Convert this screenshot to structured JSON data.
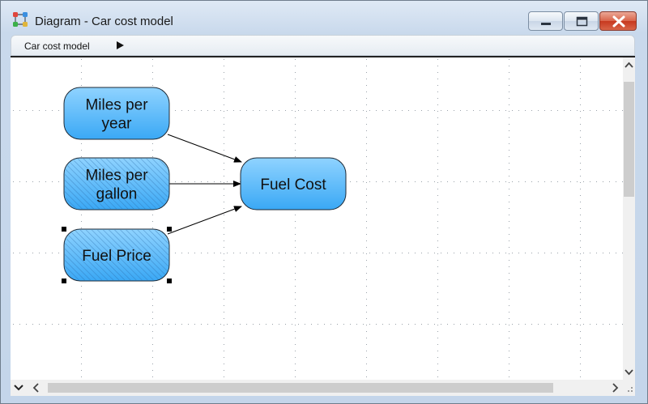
{
  "window": {
    "title": "Diagram - Car cost model",
    "icon": "diagram-app-icon"
  },
  "breadcrumb": {
    "items": [
      "Car cost model"
    ],
    "separator_icon": "triangle-right-icon"
  },
  "diagram": {
    "nodes": [
      {
        "id": "miles-per-year",
        "lines": [
          "Miles per",
          "year"
        ],
        "hatched": false,
        "selected": false
      },
      {
        "id": "miles-per-gallon",
        "lines": [
          "Miles per",
          "gallon"
        ],
        "hatched": true,
        "selected": false
      },
      {
        "id": "fuel-price",
        "lines": [
          "Fuel Price"
        ],
        "hatched": true,
        "selected": true
      },
      {
        "id": "fuel-cost",
        "lines": [
          "Fuel Cost"
        ],
        "hatched": false,
        "selected": false
      }
    ],
    "edges": [
      {
        "from": "miles-per-year",
        "to": "fuel-cost"
      },
      {
        "from": "miles-per-gallon",
        "to": "fuel-cost"
      },
      {
        "from": "fuel-price",
        "to": "fuel-cost"
      }
    ],
    "colors": {
      "node_fill_top": "#8fd3ff",
      "node_fill_bottom": "#3aa8f5",
      "node_stroke": "#1e2a36",
      "grid_dot": "#9aa2aa"
    }
  }
}
